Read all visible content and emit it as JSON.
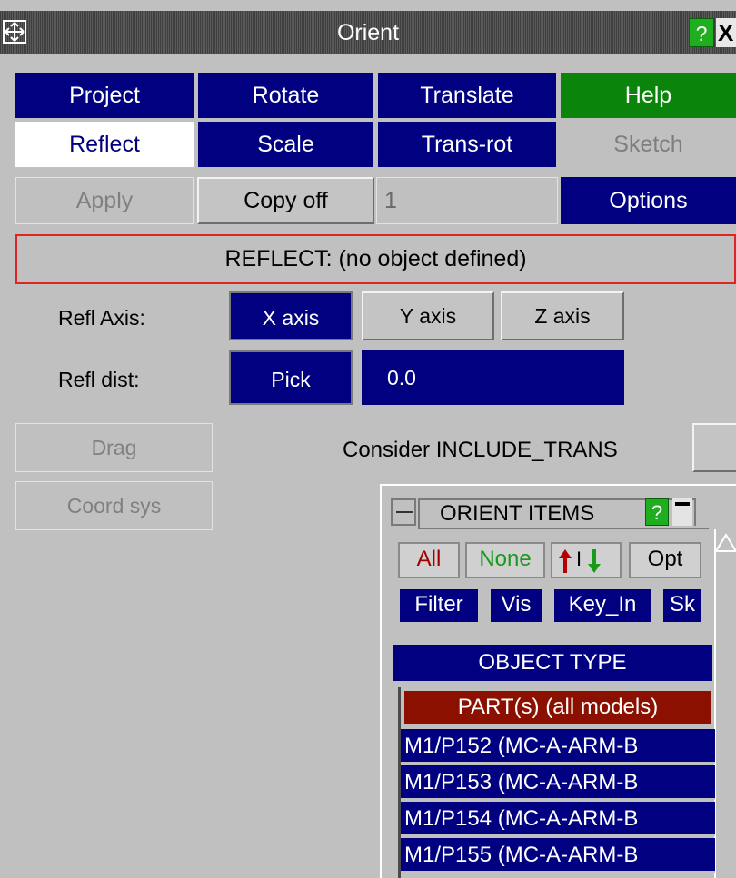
{
  "window": {
    "title": "Orient",
    "help_label": "?",
    "close_label": "X"
  },
  "tabs": {
    "row1": [
      "Project",
      "Rotate",
      "Translate",
      "Help"
    ],
    "row2": [
      "Reflect",
      "Scale",
      "Trans-rot",
      "Sketch"
    ]
  },
  "actions": {
    "apply_label": "Apply",
    "copy_label": "Copy off",
    "copy_count": "1",
    "options_label": "Options"
  },
  "status": {
    "text": "REFLECT: (no object defined)"
  },
  "reflect": {
    "axis_label": "Refl Axis:",
    "axes": [
      "X axis",
      "Y axis",
      "Z axis"
    ],
    "selected_axis": "X axis",
    "dist_label": "Refl dist:",
    "pick_label": "Pick",
    "dist_value": "0.0"
  },
  "side": {
    "drag_label": "Drag",
    "coord_label": "Coord sys",
    "include_trans_label": "Consider INCLUDE_TRANS"
  },
  "items_panel": {
    "title": "ORIENT ITEMS",
    "help_label": "?",
    "all_label": "All",
    "none_label": "None",
    "toggle_label": "I",
    "opt_label": "Opt",
    "filter_label": "Filter",
    "vis_label": "Vis",
    "keyin_label": "Key_In",
    "sk_label": "Sk",
    "object_type_label": "OBJECT TYPE",
    "list_header": "PART(s) (all models)",
    "list_rows": [
      "M1/P152 (MC-A-ARM-B",
      "M1/P153 (MC-A-ARM-B",
      "M1/P154 (MC-A-ARM-B",
      "M1/P155 (MC-A-ARM-B"
    ]
  },
  "colors": {
    "panel": "#c0c0c0",
    "navy": "#000080",
    "green": "#0b840b",
    "help_green": "#1fae1f",
    "status_border": "#e02424",
    "list_header": "#8c1000"
  }
}
